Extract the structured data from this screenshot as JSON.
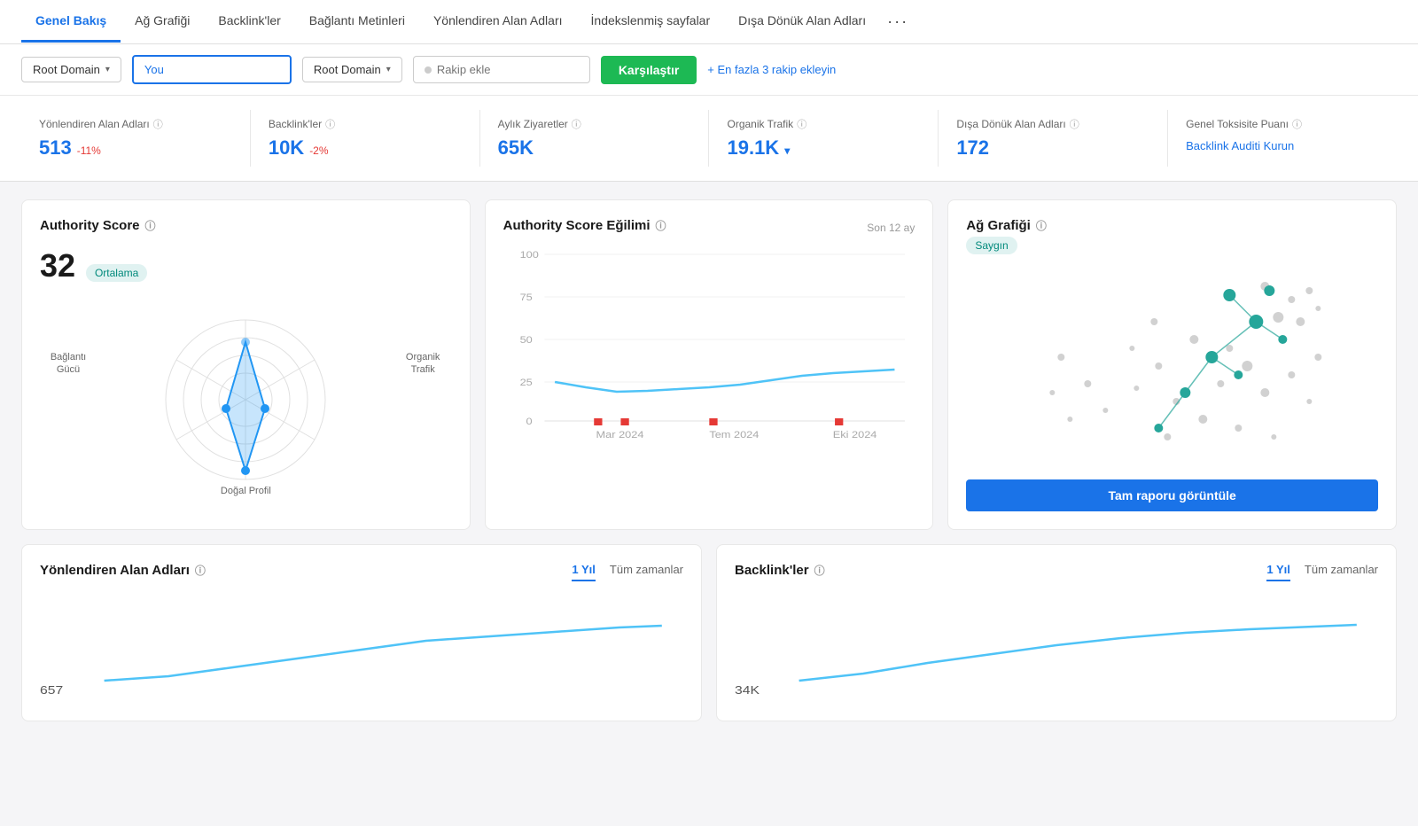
{
  "nav": {
    "items": [
      {
        "id": "genel-bakis",
        "label": "Genel Bakış",
        "active": true
      },
      {
        "id": "ag-grafigi",
        "label": "Ağ Grafiği",
        "active": false
      },
      {
        "id": "backlinkler",
        "label": "Backlink'ler",
        "active": false
      },
      {
        "id": "baglanti-metinleri",
        "label": "Bağlantı Metinleri",
        "active": false
      },
      {
        "id": "yonlendiren-alan-adlari",
        "label": "Yönlendiren Alan Adları",
        "active": false
      },
      {
        "id": "indekslenmis-sayfalar",
        "label": "İndekslenmiş sayfalar",
        "active": false
      },
      {
        "id": "disa-donuk-alan-adlari",
        "label": "Dışa Dönük Alan Adları",
        "active": false
      }
    ],
    "more_icon": "···"
  },
  "toolbar": {
    "dropdown1_label": "Root Domain",
    "dropdown2_label": "Root Domain",
    "you_value": "You",
    "competitor_placeholder": "Rakip ekle",
    "compare_btn": "Karşılaştır",
    "add_competitors": "+ En fazla 3 rakip ekleyin"
  },
  "stats": [
    {
      "label": "Yönlendiren Alan Adları",
      "value": "513",
      "change": "-11%",
      "has_change": true
    },
    {
      "label": "Backlink'ler",
      "value": "10K",
      "change": "-2%",
      "has_change": true
    },
    {
      "label": "Aylık Ziyaretler",
      "value": "65K",
      "change": "",
      "has_change": false
    },
    {
      "label": "Organik Trafik",
      "value": "19.1K",
      "change": "",
      "has_change": false,
      "has_chevron": true
    },
    {
      "label": "Dışa Dönük Alan Adları",
      "value": "172",
      "change": "",
      "has_change": false
    },
    {
      "label": "Genel Toksisite Puanı",
      "is_link": true,
      "link_text": "Backlink Auditi Kurun"
    }
  ],
  "authority_card": {
    "title": "Authority Score",
    "score": "32",
    "badge": "Ortalama",
    "labels": {
      "top_left": "Bağlantı\nGücü",
      "top_right": "Organik\nTrafik",
      "bottom": "Doğal Profil"
    }
  },
  "trend_card": {
    "title": "Authority Score Eğilimi",
    "period_label": "Son 12 ay",
    "y_labels": [
      "100",
      "75",
      "50",
      "25",
      "0"
    ],
    "x_labels": [
      "Mar 2024",
      "Tem 2024",
      "Eki 2024"
    ]
  },
  "network_card": {
    "title": "Ağ Grafiği",
    "badge": "Saygın",
    "btn_label": "Tam raporu görüntüle"
  },
  "referring_domains_card": {
    "title": "Yönlendiren Alan Adları",
    "tab1": "1 Yıl",
    "tab2": "Tüm zamanlar",
    "value_hint": "657"
  },
  "backlinks_card": {
    "title": "Backlink'ler",
    "tab1": "1 Yıl",
    "tab2": "Tüm zamanlar",
    "value_hint": "34K"
  },
  "colors": {
    "blue": "#1a73e8",
    "green": "#1db954",
    "teal": "#00897b",
    "red": "#e53935",
    "chart_blue": "#4fc3f7",
    "network_green": "#26a69a"
  }
}
